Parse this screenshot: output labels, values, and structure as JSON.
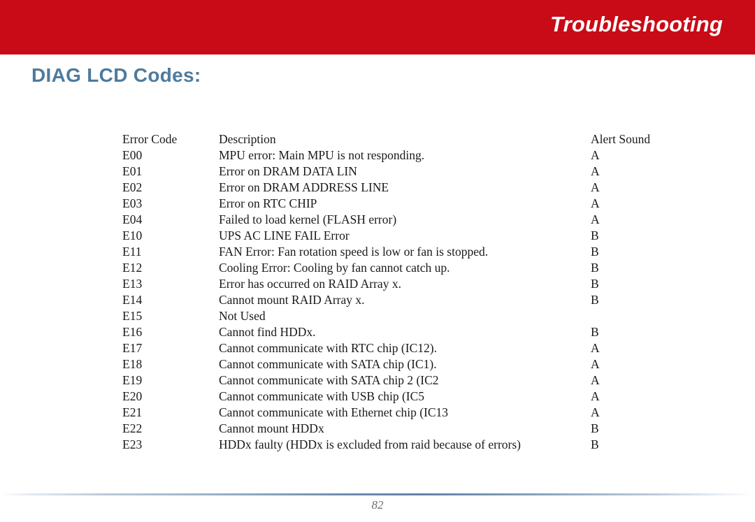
{
  "header": {
    "title": "Troubleshooting",
    "banner_color": "#c80b17",
    "title_color": "#ffffff"
  },
  "section": {
    "heading": "DIAG LCD Codes:",
    "heading_color": "#4d7b9e"
  },
  "table": {
    "columns": [
      "Error Code",
      "Description",
      "Alert Sound"
    ],
    "rows": [
      {
        "code": "E00",
        "description": "MPU error: Main MPU is not responding.",
        "alert": "A"
      },
      {
        "code": "E01",
        "description": "Error on DRAM DATA LIN",
        "alert": "A"
      },
      {
        "code": "E02",
        "description": "Error on DRAM ADDRESS LINE",
        "alert": "A"
      },
      {
        "code": "E03",
        "description": "Error on RTC CHIP",
        "alert": "A"
      },
      {
        "code": "E04",
        "description": "Failed to load kernel (FLASH error)",
        "alert": "A"
      },
      {
        "code": "E10",
        "description": "UPS AC LINE FAIL Error",
        "alert": "B"
      },
      {
        "code": "E11",
        "description": "FAN Error: Fan rotation speed is low or fan is stopped.",
        "alert": "B"
      },
      {
        "code": "E12",
        "description": "Cooling Error: Cooling by fan cannot catch up.",
        "alert": "B"
      },
      {
        "code": "E13",
        "description": "Error has occurred on RAID Array x.",
        "alert": "B"
      },
      {
        "code": "E14",
        "description": "Cannot mount RAID Array x.",
        "alert": "B"
      },
      {
        "code": "E15",
        "description": "Not Used",
        "alert": ""
      },
      {
        "code": "E16",
        "description": "Cannot find HDDx.",
        "alert": "B"
      },
      {
        "code": "E17",
        "description": "Cannot communicate with RTC chip (IC12).",
        "alert": "A"
      },
      {
        "code": "E18",
        "description": "Cannot communicate with SATA chip (IC1).",
        "alert": "A"
      },
      {
        "code": "E19",
        "description": "Cannot communicate with SATA chip 2 (IC2",
        "alert": "A"
      },
      {
        "code": "E20",
        "description": "Cannot communicate with USB chip (IC5",
        "alert": "A"
      },
      {
        "code": "E21",
        "description": "Cannot communicate with Ethernet chip (IC13",
        "alert": "A"
      },
      {
        "code": "E22",
        "description": "Cannot mount HDDx",
        "alert": "B"
      },
      {
        "code": "E23",
        "description": "HDDx faulty (HDDx is excluded from raid because of errors)",
        "alert": "B"
      }
    ]
  },
  "footer": {
    "page_number": "82",
    "rule_color": "#6c8dae"
  }
}
